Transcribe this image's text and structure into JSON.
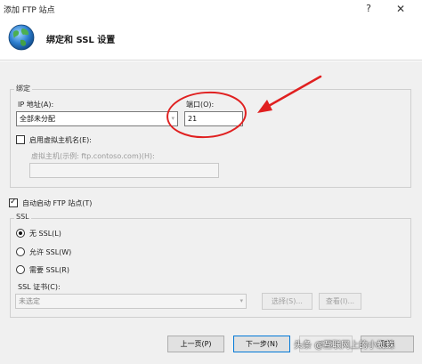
{
  "window": {
    "title": "添加 FTP 站点",
    "help_glyph": "?",
    "close_glyph": "✕"
  },
  "header": {
    "title": "绑定和 SSL 设置"
  },
  "binding": {
    "group_label": "绑定",
    "ip_label": "IP 地址(A):",
    "ip_value": "全部未分配",
    "port_label": "端口(O):",
    "port_value": "21",
    "vhost_checkbox_label": "启用虚拟主机名(E):",
    "vhost_hint": "虚拟主机(示例: ftp.contoso.com)(H):",
    "vhost_value": ""
  },
  "autostart": {
    "label": "自动启动 FTP 站点(T)",
    "checked": true
  },
  "ssl": {
    "group_label": "SSL",
    "options": [
      "无 SSL(L)",
      "允许 SSL(W)",
      "需要 SSL(R)"
    ],
    "selected_index": 0,
    "cert_label": "SSL 证书(C):",
    "cert_value": "未选定",
    "select_button": "选择(S)...",
    "view_button": "查看(I)..."
  },
  "footer": {
    "prev_button": "上一页(P)",
    "next_button": "下一步(N)",
    "finish_button": "完成",
    "cancel_button": "取消"
  },
  "watermark": {
    "text": "头条 @互联网上的小蜘蛛"
  },
  "colors": {
    "annotation_red": "#e02020",
    "dialog_bg": "#f0f0f0",
    "primary_border": "#0078d7"
  }
}
